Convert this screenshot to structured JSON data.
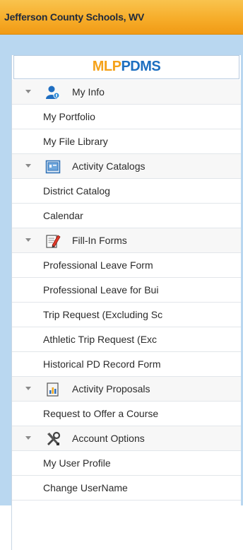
{
  "header": {
    "title": "Jefferson County Schools, WV"
  },
  "logo": {
    "part1": "MLP",
    "part2": "PDMS"
  },
  "menu": [
    {
      "label": "My Info",
      "icon": "user-icon",
      "items": [
        "My Portfolio",
        "My File Library"
      ]
    },
    {
      "label": "Activity Catalogs",
      "icon": "catalog-icon",
      "items": [
        "District Catalog",
        "Calendar"
      ]
    },
    {
      "label": "Fill-In Forms",
      "icon": "form-pencil-icon",
      "items": [
        "Professional Leave Form",
        "Professional Leave for Bui",
        "Trip Request (Excluding Sc",
        "Athletic Trip Request (Exc",
        "Historical PD Record Form"
      ]
    },
    {
      "label": "Activity Proposals",
      "icon": "proposal-chart-icon",
      "items": [
        "Request to Offer a Course"
      ]
    },
    {
      "label": "Account Options",
      "icon": "tools-icon",
      "items": [
        "My User Profile",
        "Change UserName"
      ]
    }
  ],
  "colors": {
    "header_orange": "#f6ad2a",
    "frame_blue": "#b9d7f0",
    "logo_orange": "#f5a21a",
    "logo_blue": "#1d6fc0"
  }
}
